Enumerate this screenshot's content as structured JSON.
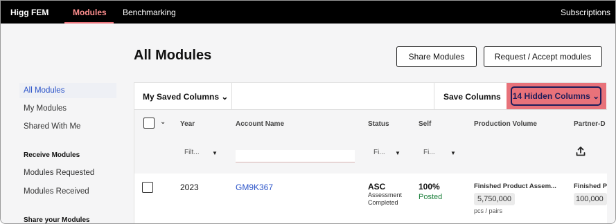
{
  "topbar": {
    "brand": "Higg FEM",
    "nav": {
      "modules": "Modules",
      "benchmarking": "Benchmarking"
    },
    "subscriptions": "Subscriptions"
  },
  "sidebar": {
    "items": [
      {
        "label": "All Modules",
        "active": true
      },
      {
        "label": "My Modules"
      },
      {
        "label": "Shared With Me"
      }
    ],
    "receive_heading": "Receive Modules",
    "receive_items": [
      {
        "label": "Modules Requested"
      },
      {
        "label": "Modules Received"
      }
    ],
    "share_heading": "Share your Modules"
  },
  "page": {
    "title": "All Modules",
    "share_button": "Share Modules",
    "request_button": "Request / Accept modules"
  },
  "toolbar": {
    "saved_columns": "My Saved Columns ⌄",
    "save_columns": "Save Columns",
    "hidden_columns": "14 Hidden Columns ⌄"
  },
  "table": {
    "headers": {
      "year": "Year",
      "account_name": "Account Name",
      "status": "Status",
      "self": "Self",
      "production_volume": "Production Volume",
      "partner": "Partner-D"
    },
    "filters": {
      "year": "Filt...",
      "status": "Fi...",
      "self": "Fi..."
    },
    "rows": [
      {
        "year": "2023",
        "account": "GM9K367",
        "status_main": "ASC",
        "status_sub1": "Assessment",
        "status_sub2": "Completed",
        "self_value": "100%",
        "self_status": "Posted",
        "pv_label": "Finished Product Assem...",
        "pv_value": "5,750,000",
        "pv_unit": "pcs / pairs",
        "partner_label": "Finished P",
        "partner_value": "100,000"
      }
    ]
  },
  "colors": {
    "accent": "#e8727a",
    "link": "#2952c8",
    "posted": "#1a7f3a",
    "hidden_btn": "#1d1d5a"
  },
  "icons": [
    "chevron-down-icon",
    "upload-icon",
    "caret-down-icon"
  ]
}
